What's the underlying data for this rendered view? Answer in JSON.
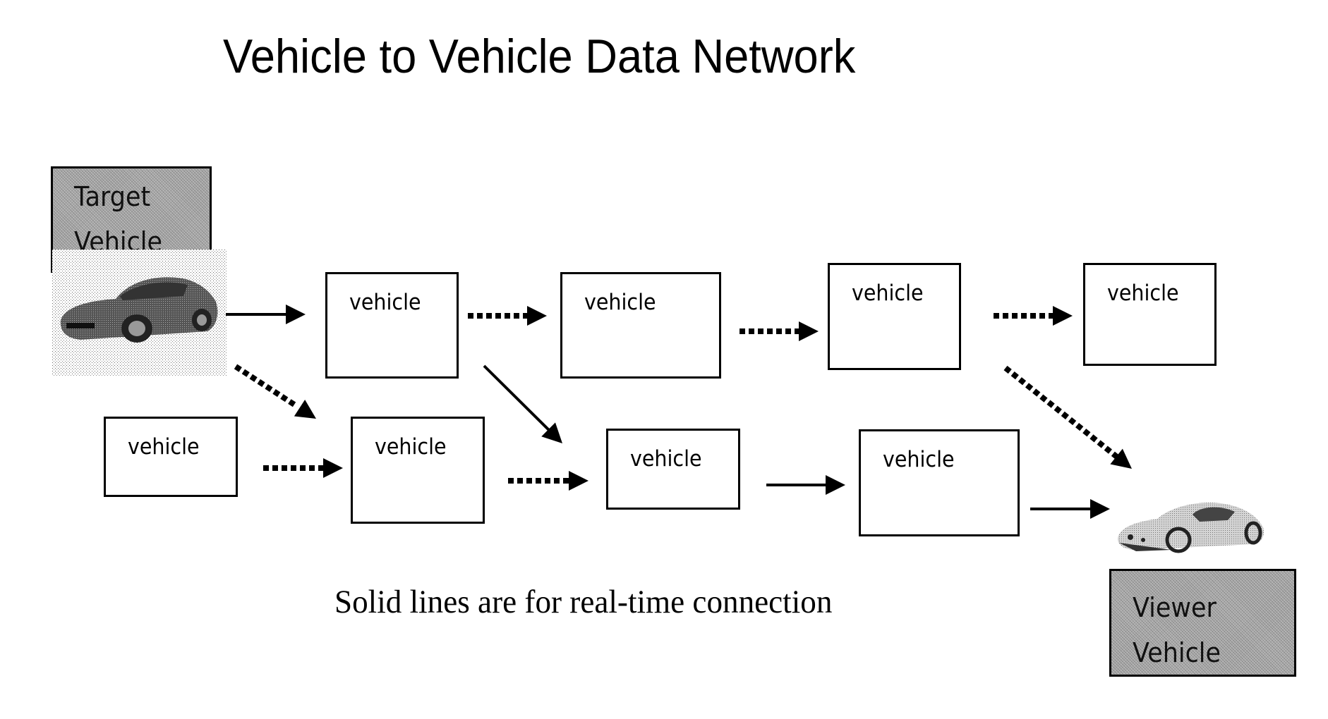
{
  "diagram": {
    "title": "Vehicle to Vehicle Data Network",
    "caption": "Solid lines are for real-time connection",
    "target": {
      "line1": "Target",
      "line2": "Vehicle",
      "image_icon": "sports-car-dark-icon"
    },
    "viewer": {
      "line1": "Viewer",
      "line2": "Vehicle",
      "image_icon": "sports-car-light-icon"
    },
    "nodes": [
      {
        "id": "A",
        "label": "vehicle"
      },
      {
        "id": "B",
        "label": "vehicle"
      },
      {
        "id": "C",
        "label": "vehicle"
      },
      {
        "id": "D",
        "label": "vehicle"
      },
      {
        "id": "E",
        "label": "vehicle"
      },
      {
        "id": "F",
        "label": "vehicle"
      },
      {
        "id": "G",
        "label": "vehicle"
      },
      {
        "id": "H",
        "label": "vehicle"
      }
    ],
    "edges": [
      {
        "from": "target",
        "to": "A",
        "style": "solid"
      },
      {
        "from": "A",
        "to": "B",
        "style": "dotted"
      },
      {
        "from": "B",
        "to": "C",
        "style": "dotted"
      },
      {
        "from": "C",
        "to": "D",
        "style": "dotted"
      },
      {
        "from": "target",
        "to": "F",
        "style": "dotted"
      },
      {
        "from": "A",
        "to": "G",
        "style": "solid"
      },
      {
        "from": "E",
        "to": "F",
        "style": "dotted"
      },
      {
        "from": "F",
        "to": "G",
        "style": "dotted"
      },
      {
        "from": "G",
        "to": "H",
        "style": "solid"
      },
      {
        "from": "H",
        "to": "viewer",
        "style": "solid"
      },
      {
        "from": "D",
        "to": "viewer",
        "style": "dotted"
      }
    ]
  }
}
